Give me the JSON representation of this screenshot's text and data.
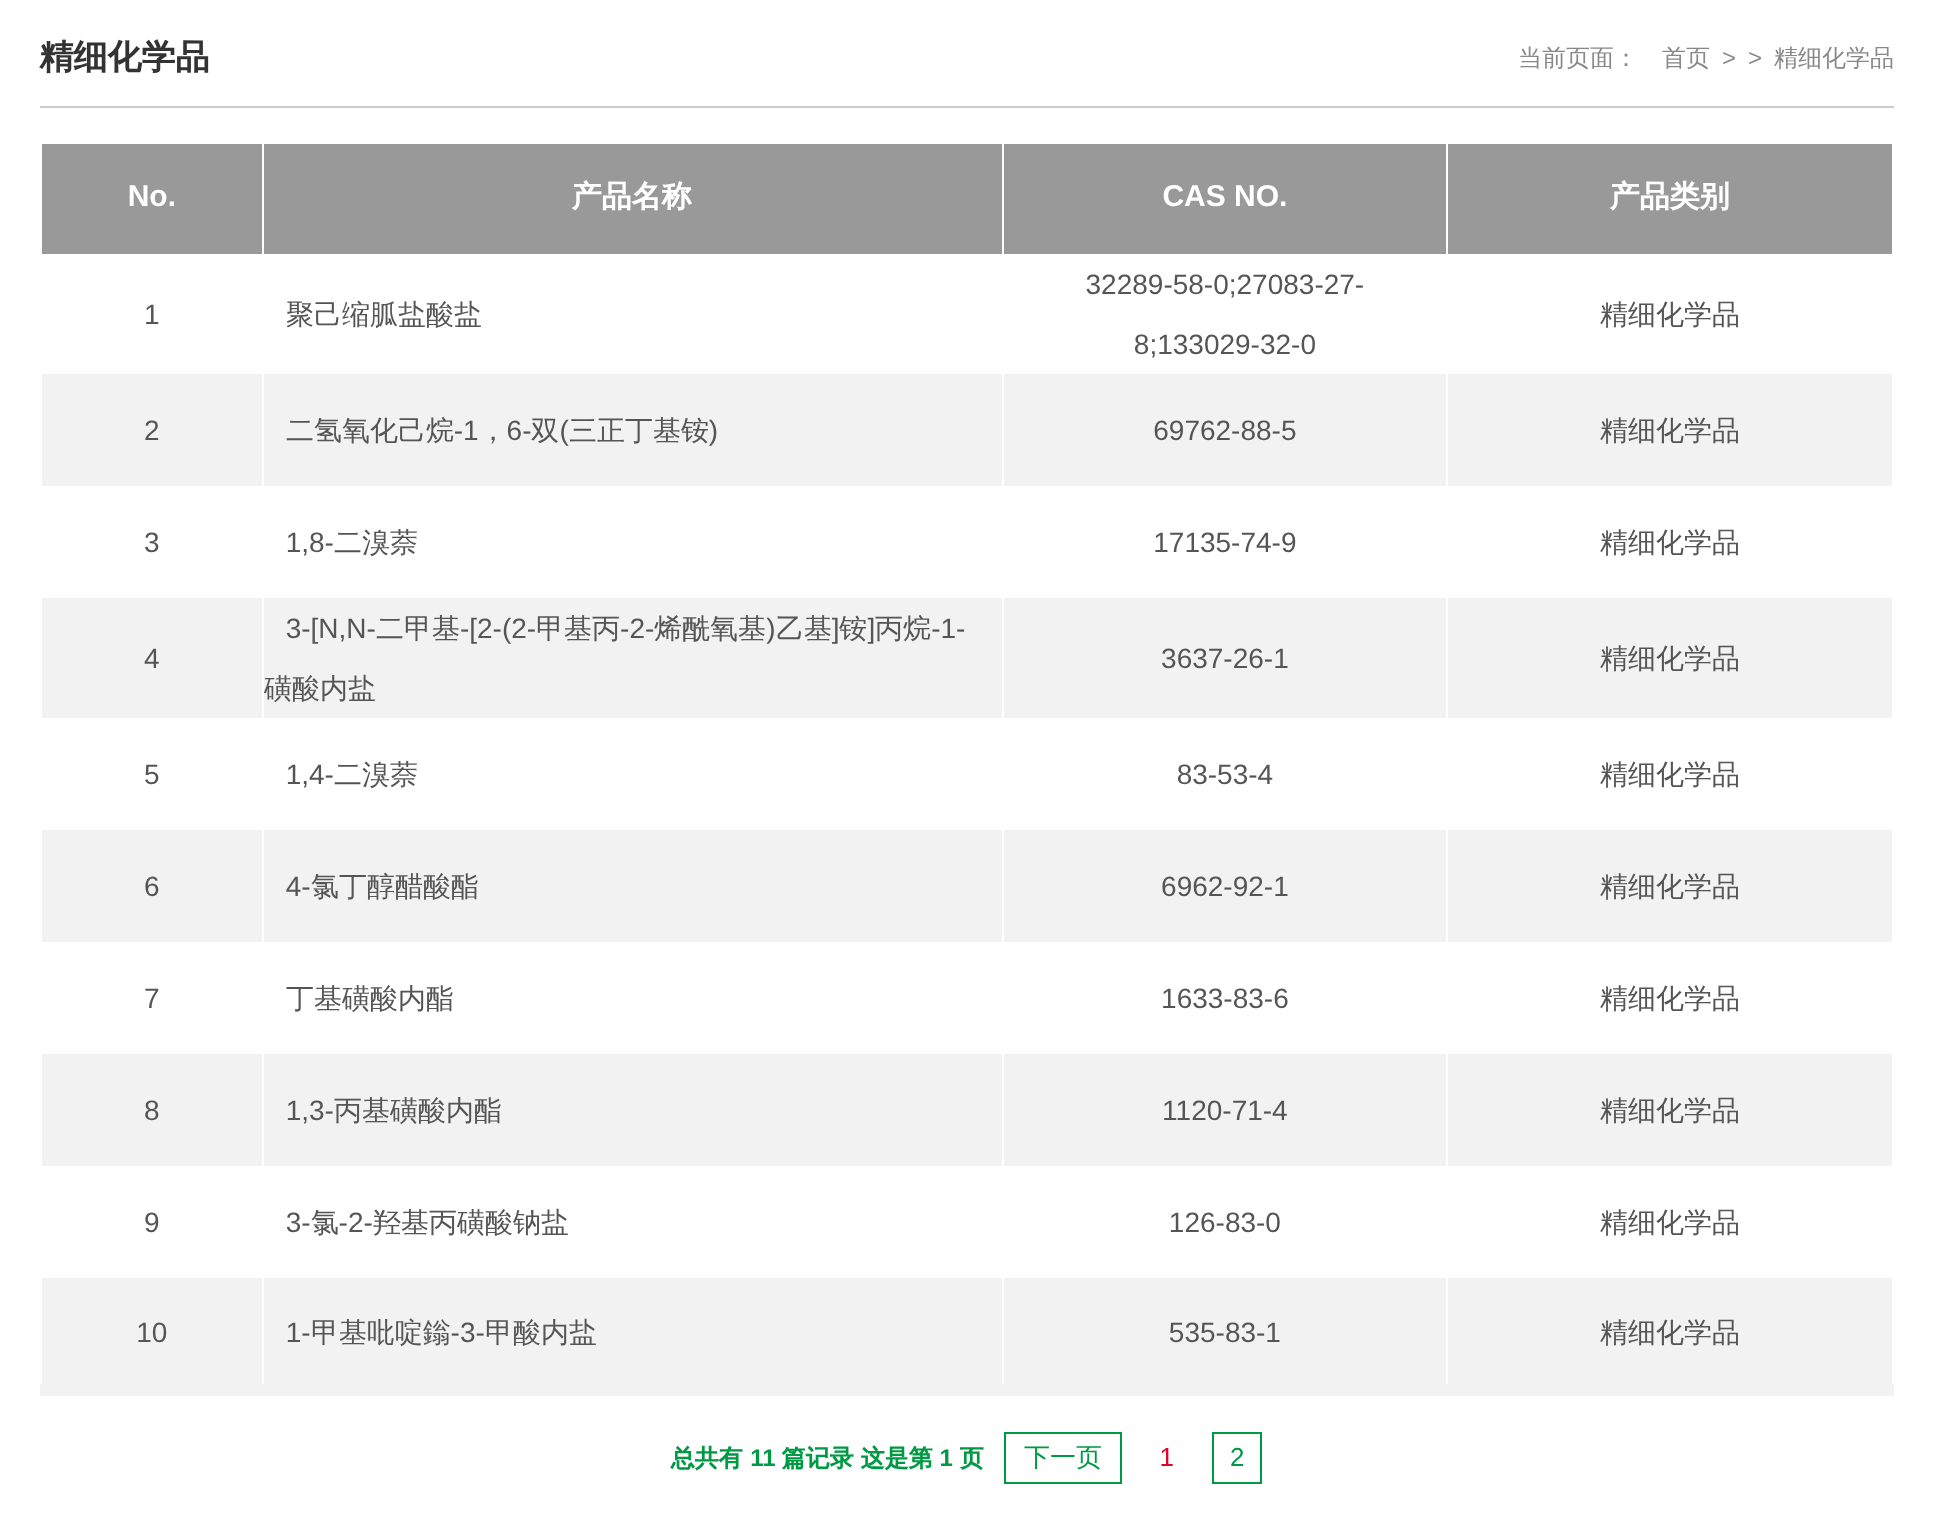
{
  "title": "精细化学品",
  "breadcrumb": {
    "label": "当前页面：",
    "items": [
      "首页",
      ">",
      ">",
      "精细化学品"
    ]
  },
  "table": {
    "columns": [
      "No.",
      "产品名称",
      "CAS NO.",
      "产品类别"
    ],
    "rows": [
      [
        "1",
        "聚己缩胍盐酸盐",
        "32289-58-0;27083-27-8;133029-32-0",
        "精细化学品"
      ],
      [
        "2",
        "二氢氧化己烷-1，6-双(三正丁基铵)",
        "69762-88-5",
        "精细化学品"
      ],
      [
        "3",
        "1,8-二溴萘",
        "17135-74-9",
        "精细化学品"
      ],
      [
        "4",
        "3-[N,N-二甲基-[2-(2-甲基丙-2-烯酰氧基)乙基]铵]丙烷-1-磺酸内盐",
        "3637-26-1",
        "精细化学品"
      ],
      [
        "5",
        "1,4-二溴萘",
        "83-53-4",
        "精细化学品"
      ],
      [
        "6",
        "4-氯丁醇醋酸酯",
        "6962-92-1",
        "精细化学品"
      ],
      [
        "7",
        "丁基磺酸内酯",
        "1633-83-6",
        "精细化学品"
      ],
      [
        "8",
        "1,3-丙基磺酸内酯",
        "1120-71-4",
        "精细化学品"
      ],
      [
        "9",
        "3-氯-2-羟基丙磺酸钠盐",
        "126-83-0",
        "精细化学品"
      ],
      [
        "10",
        "1-甲基吡啶鎓-3-甲酸内盐",
        "535-83-1",
        "精细化学品"
      ]
    ]
  },
  "pagination": {
    "summary": "总共有 **11** 篇记录 这是第 **1** 页",
    "next": "下一页",
    "pages": [
      {
        "label": "1",
        "selected": true
      },
      {
        "label": "2",
        "selected": false
      }
    ]
  }
}
